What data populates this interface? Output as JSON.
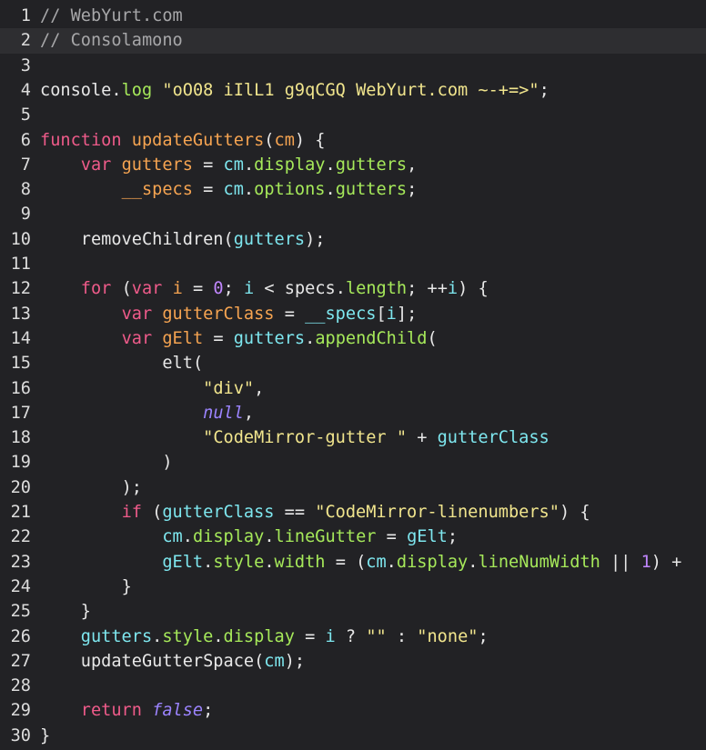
{
  "editor": {
    "active_line": 2,
    "lines": [
      {
        "n": "1",
        "tokens": [
          {
            "t": "// WebYurt.com",
            "c": "comment"
          }
        ]
      },
      {
        "n": "2",
        "tokens": [
          {
            "t": "// Consolamono",
            "c": "comment"
          }
        ]
      },
      {
        "n": "3",
        "tokens": []
      },
      {
        "n": "4",
        "tokens": [
          {
            "t": "console",
            "c": "plain"
          },
          {
            "t": ".",
            "c": "op"
          },
          {
            "t": "log",
            "c": "prop"
          },
          {
            "t": " ",
            "c": "plain"
          },
          {
            "t": "\"oO08 iIlL1 g9qCGQ WebYurt.com ~-+=>\"",
            "c": "string"
          },
          {
            "t": ";",
            "c": "op"
          }
        ]
      },
      {
        "n": "5",
        "tokens": []
      },
      {
        "n": "6",
        "tokens": [
          {
            "t": "function",
            "c": "keyword"
          },
          {
            "t": " ",
            "c": "plain"
          },
          {
            "t": "updateGutters",
            "c": "def"
          },
          {
            "t": "(",
            "c": "op"
          },
          {
            "t": "cm",
            "c": "def"
          },
          {
            "t": ") {",
            "c": "op"
          }
        ]
      },
      {
        "n": "7",
        "tokens": [
          {
            "t": "    ",
            "c": "plain"
          },
          {
            "t": "var",
            "c": "keyword"
          },
          {
            "t": " ",
            "c": "plain"
          },
          {
            "t": "gutters",
            "c": "def"
          },
          {
            "t": " = ",
            "c": "op"
          },
          {
            "t": "cm",
            "c": "variable"
          },
          {
            "t": ".",
            "c": "op"
          },
          {
            "t": "display",
            "c": "prop"
          },
          {
            "t": ".",
            "c": "op"
          },
          {
            "t": "gutters",
            "c": "prop"
          },
          {
            "t": ",",
            "c": "op"
          }
        ]
      },
      {
        "n": "8",
        "tokens": [
          {
            "t": "        ",
            "c": "plain"
          },
          {
            "t": "__specs",
            "c": "def"
          },
          {
            "t": " = ",
            "c": "op"
          },
          {
            "t": "cm",
            "c": "variable"
          },
          {
            "t": ".",
            "c": "op"
          },
          {
            "t": "options",
            "c": "prop"
          },
          {
            "t": ".",
            "c": "op"
          },
          {
            "t": "gutters",
            "c": "prop"
          },
          {
            "t": ";",
            "c": "op"
          }
        ]
      },
      {
        "n": "9",
        "tokens": []
      },
      {
        "n": "10",
        "tokens": [
          {
            "t": "    ",
            "c": "plain"
          },
          {
            "t": "removeChildren",
            "c": "plain"
          },
          {
            "t": "(",
            "c": "op"
          },
          {
            "t": "gutters",
            "c": "variable"
          },
          {
            "t": ");",
            "c": "op"
          }
        ]
      },
      {
        "n": "11",
        "tokens": []
      },
      {
        "n": "12",
        "tokens": [
          {
            "t": "    ",
            "c": "plain"
          },
          {
            "t": "for",
            "c": "keyword"
          },
          {
            "t": " (",
            "c": "op"
          },
          {
            "t": "var",
            "c": "keyword"
          },
          {
            "t": " ",
            "c": "plain"
          },
          {
            "t": "i",
            "c": "def"
          },
          {
            "t": " = ",
            "c": "op"
          },
          {
            "t": "0",
            "c": "number"
          },
          {
            "t": "; ",
            "c": "op"
          },
          {
            "t": "i",
            "c": "variable"
          },
          {
            "t": " < ",
            "c": "op"
          },
          {
            "t": "specs",
            "c": "plain"
          },
          {
            "t": ".",
            "c": "op"
          },
          {
            "t": "length",
            "c": "prop"
          },
          {
            "t": "; ++",
            "c": "op"
          },
          {
            "t": "i",
            "c": "variable"
          },
          {
            "t": ") {",
            "c": "op"
          }
        ]
      },
      {
        "n": "13",
        "tokens": [
          {
            "t": "        ",
            "c": "plain"
          },
          {
            "t": "var",
            "c": "keyword"
          },
          {
            "t": " ",
            "c": "plain"
          },
          {
            "t": "gutterClass",
            "c": "def"
          },
          {
            "t": " = ",
            "c": "op"
          },
          {
            "t": "__specs",
            "c": "variable"
          },
          {
            "t": "[",
            "c": "op"
          },
          {
            "t": "i",
            "c": "variable"
          },
          {
            "t": "];",
            "c": "op"
          }
        ]
      },
      {
        "n": "14",
        "tokens": [
          {
            "t": "        ",
            "c": "plain"
          },
          {
            "t": "var",
            "c": "keyword"
          },
          {
            "t": " ",
            "c": "plain"
          },
          {
            "t": "gElt",
            "c": "def"
          },
          {
            "t": " = ",
            "c": "op"
          },
          {
            "t": "gutters",
            "c": "variable"
          },
          {
            "t": ".",
            "c": "op"
          },
          {
            "t": "appendChild",
            "c": "prop"
          },
          {
            "t": "(",
            "c": "op"
          }
        ]
      },
      {
        "n": "15",
        "tokens": [
          {
            "t": "            ",
            "c": "plain"
          },
          {
            "t": "elt",
            "c": "plain"
          },
          {
            "t": "(",
            "c": "op"
          }
        ]
      },
      {
        "n": "16",
        "tokens": [
          {
            "t": "                ",
            "c": "plain"
          },
          {
            "t": "\"div\"",
            "c": "string"
          },
          {
            "t": ",",
            "c": "op"
          }
        ]
      },
      {
        "n": "17",
        "tokens": [
          {
            "t": "                ",
            "c": "plain"
          },
          {
            "t": "null",
            "c": "atom"
          },
          {
            "t": ",",
            "c": "op"
          }
        ]
      },
      {
        "n": "18",
        "tokens": [
          {
            "t": "                ",
            "c": "plain"
          },
          {
            "t": "\"CodeMirror-gutter \"",
            "c": "string"
          },
          {
            "t": " + ",
            "c": "op"
          },
          {
            "t": "gutterClass",
            "c": "variable"
          }
        ]
      },
      {
        "n": "19",
        "tokens": [
          {
            "t": "            ",
            "c": "plain"
          },
          {
            "t": ")",
            "c": "op"
          }
        ]
      },
      {
        "n": "20",
        "tokens": [
          {
            "t": "        ",
            "c": "plain"
          },
          {
            "t": ");",
            "c": "op"
          }
        ]
      },
      {
        "n": "21",
        "tokens": [
          {
            "t": "        ",
            "c": "plain"
          },
          {
            "t": "if",
            "c": "keyword"
          },
          {
            "t": " (",
            "c": "op"
          },
          {
            "t": "gutterClass",
            "c": "variable"
          },
          {
            "t": " == ",
            "c": "op"
          },
          {
            "t": "\"CodeMirror-linenumbers\"",
            "c": "string"
          },
          {
            "t": ") {",
            "c": "op"
          }
        ]
      },
      {
        "n": "22",
        "tokens": [
          {
            "t": "            ",
            "c": "plain"
          },
          {
            "t": "cm",
            "c": "variable"
          },
          {
            "t": ".",
            "c": "op"
          },
          {
            "t": "display",
            "c": "prop"
          },
          {
            "t": ".",
            "c": "op"
          },
          {
            "t": "lineGutter",
            "c": "prop"
          },
          {
            "t": " = ",
            "c": "op"
          },
          {
            "t": "gElt",
            "c": "variable"
          },
          {
            "t": ";",
            "c": "op"
          }
        ]
      },
      {
        "n": "23",
        "tokens": [
          {
            "t": "            ",
            "c": "plain"
          },
          {
            "t": "gElt",
            "c": "variable"
          },
          {
            "t": ".",
            "c": "op"
          },
          {
            "t": "style",
            "c": "prop"
          },
          {
            "t": ".",
            "c": "op"
          },
          {
            "t": "width",
            "c": "prop"
          },
          {
            "t": " = (",
            "c": "op"
          },
          {
            "t": "cm",
            "c": "variable"
          },
          {
            "t": ".",
            "c": "op"
          },
          {
            "t": "display",
            "c": "prop"
          },
          {
            "t": ".",
            "c": "op"
          },
          {
            "t": "lineNumWidth",
            "c": "prop"
          },
          {
            "t": " || ",
            "c": "op"
          },
          {
            "t": "1",
            "c": "number"
          },
          {
            "t": ") +",
            "c": "op"
          }
        ]
      },
      {
        "n": "24",
        "tokens": [
          {
            "t": "        ",
            "c": "plain"
          },
          {
            "t": "}",
            "c": "op"
          }
        ]
      },
      {
        "n": "25",
        "tokens": [
          {
            "t": "    ",
            "c": "plain"
          },
          {
            "t": "}",
            "c": "op"
          }
        ]
      },
      {
        "n": "26",
        "tokens": [
          {
            "t": "    ",
            "c": "plain"
          },
          {
            "t": "gutters",
            "c": "variable"
          },
          {
            "t": ".",
            "c": "op"
          },
          {
            "t": "style",
            "c": "prop"
          },
          {
            "t": ".",
            "c": "op"
          },
          {
            "t": "display",
            "c": "prop"
          },
          {
            "t": " = ",
            "c": "op"
          },
          {
            "t": "i",
            "c": "variable"
          },
          {
            "t": " ? ",
            "c": "op"
          },
          {
            "t": "\"\"",
            "c": "string"
          },
          {
            "t": " : ",
            "c": "op"
          },
          {
            "t": "\"none\"",
            "c": "string"
          },
          {
            "t": ";",
            "c": "op"
          }
        ]
      },
      {
        "n": "27",
        "tokens": [
          {
            "t": "    ",
            "c": "plain"
          },
          {
            "t": "updateGutterSpace",
            "c": "plain"
          },
          {
            "t": "(",
            "c": "op"
          },
          {
            "t": "cm",
            "c": "variable"
          },
          {
            "t": ");",
            "c": "op"
          }
        ]
      },
      {
        "n": "28",
        "tokens": []
      },
      {
        "n": "29",
        "tokens": [
          {
            "t": "    ",
            "c": "plain"
          },
          {
            "t": "return",
            "c": "keyword"
          },
          {
            "t": " ",
            "c": "plain"
          },
          {
            "t": "false",
            "c": "atom"
          },
          {
            "t": ";",
            "c": "op"
          }
        ]
      },
      {
        "n": "30",
        "tokens": [
          {
            "t": "}",
            "c": "op"
          }
        ]
      }
    ]
  }
}
